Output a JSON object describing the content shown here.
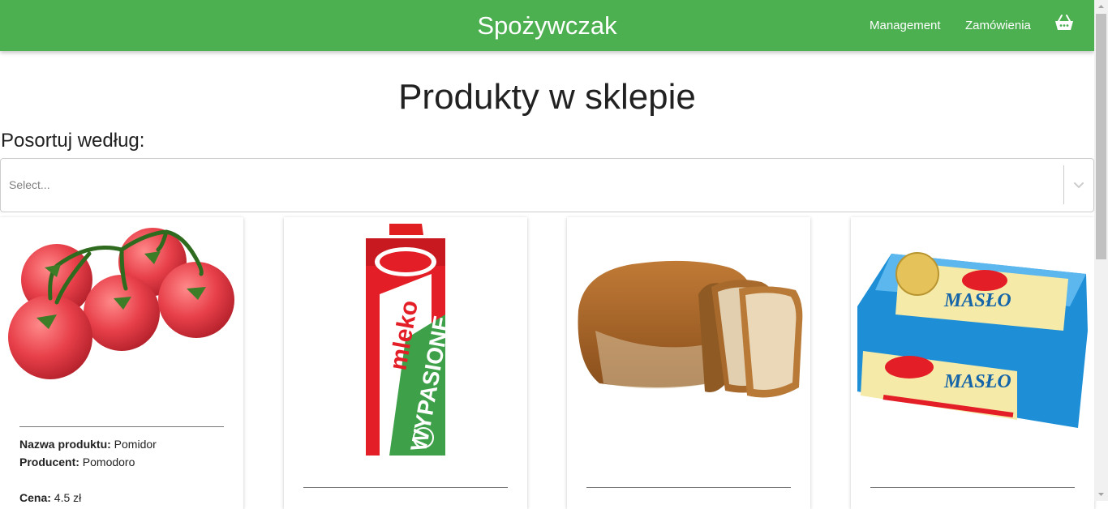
{
  "navbar": {
    "brand": "Spożywczak",
    "links": [
      "Management",
      "Zamówienia"
    ],
    "cart_icon": "basket-icon",
    "color": "#4caf50"
  },
  "page": {
    "title": "Produkty w sklepie",
    "sort_label": "Posortuj według:",
    "select_placeholder": "Select..."
  },
  "labels": {
    "name": "Nazwa produktu:",
    "producer": "Producent:",
    "price": "Cena:"
  },
  "products": [
    {
      "name": "Pomidor",
      "producer": "Pomodoro",
      "price": "4.5 zł",
      "image": "tomatoes-image"
    },
    {
      "image": "milk-carton-image"
    },
    {
      "image": "bread-image"
    },
    {
      "image": "butter-image"
    }
  ]
}
